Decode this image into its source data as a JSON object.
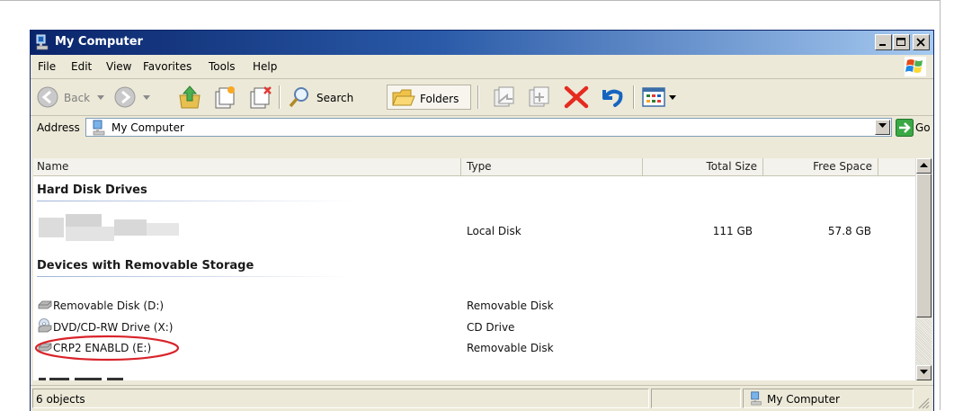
{
  "window": {
    "title": "My Computer"
  },
  "menu": {
    "items": [
      "File",
      "Edit",
      "View",
      "Favorites",
      "Tools",
      "Help"
    ]
  },
  "toolbar": {
    "back_label": "Back",
    "search_label": "Search",
    "folders_label": "Folders"
  },
  "address": {
    "label": "Address",
    "value": "My Computer",
    "go_label": "Go"
  },
  "columns": {
    "name": "Name",
    "type": "Type",
    "total_size": "Total Size",
    "free_space": "Free Space"
  },
  "groups": {
    "hard_disk": {
      "title": "Hard Disk Drives",
      "items": [
        {
          "name": "",
          "type": "Local Disk",
          "total_size": "111 GB",
          "free_space": "57.8 GB"
        }
      ]
    },
    "removable": {
      "title": "Devices with Removable Storage",
      "items": [
        {
          "name": "Removable Disk (D:)",
          "type": "Removable Disk",
          "icon": "drive-icon"
        },
        {
          "name": "DVD/CD-RW Drive (X:)",
          "type": "CD Drive",
          "icon": "cd-drive-icon"
        },
        {
          "name": "CRP2 ENABLD (E:)",
          "type": "Removable Disk",
          "icon": "drive-icon",
          "highlighted": true
        }
      ]
    }
  },
  "status": {
    "left": "6 objects",
    "right": "My Computer"
  },
  "colors": {
    "title_start": "#0a246a",
    "title_end": "#a6caf0",
    "highlight": "#d9232a",
    "chrome": "#ece9d8"
  }
}
